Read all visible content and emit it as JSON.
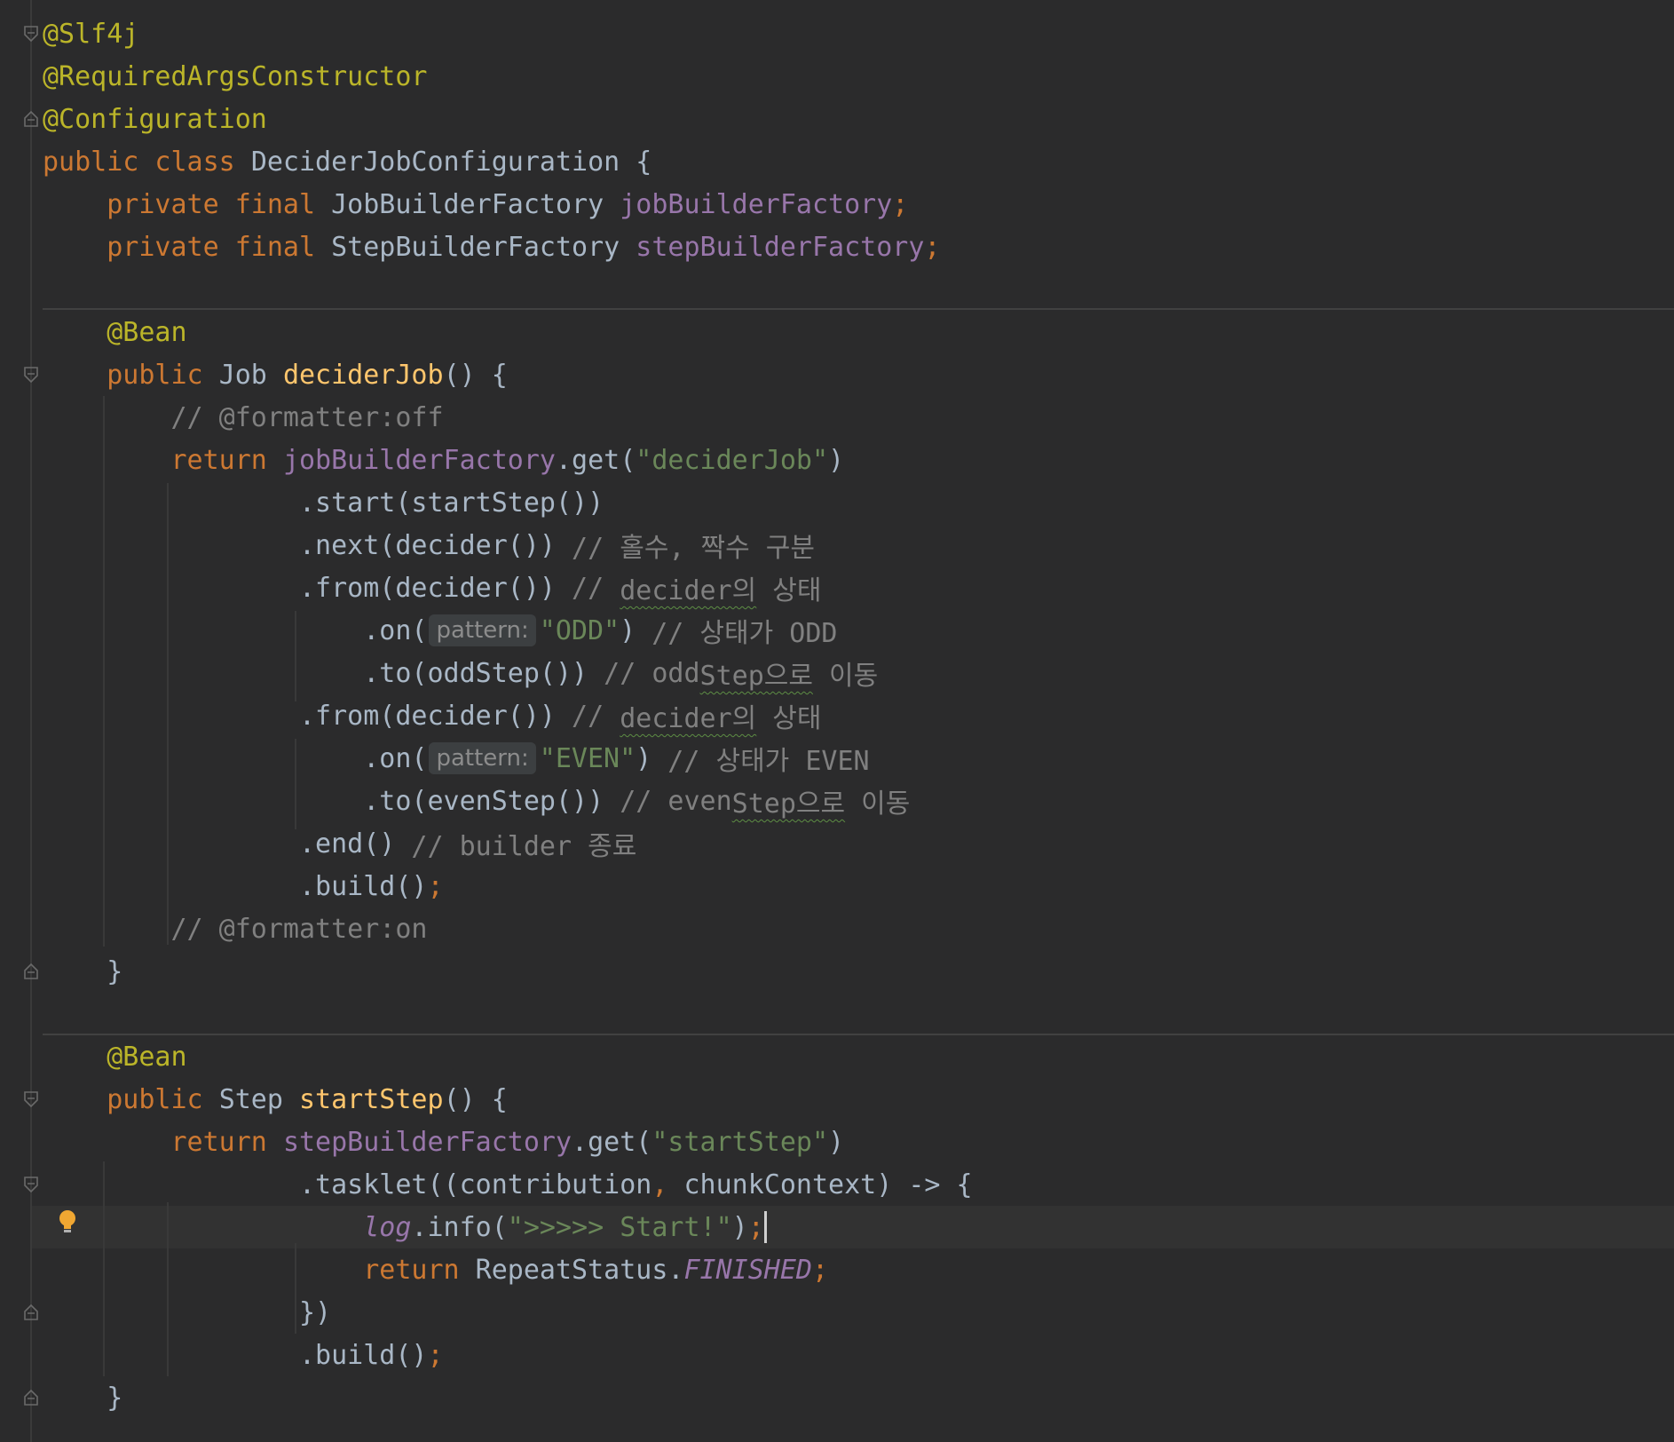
{
  "colors": {
    "background": "#2b2b2c",
    "keyword": "#cc7832",
    "annotation": "#bbb529",
    "field": "#9876aa",
    "method_declaration": "#ffc66d",
    "string": "#6a8759",
    "comment": "#808080",
    "plain": "#a9b7c6"
  },
  "icons": {
    "fold_markers": "fold-marker-icon",
    "intention": "lightbulb-icon"
  },
  "lines": [
    {
      "tokens": [
        {
          "t": "@Slf4j",
          "c": "ann"
        }
      ]
    },
    {
      "tokens": [
        {
          "t": "@RequiredArgsConstructor",
          "c": "ann"
        }
      ]
    },
    {
      "tokens": [
        {
          "t": "@Configuration",
          "c": "ann"
        }
      ]
    },
    {
      "tokens": [
        {
          "t": "public class ",
          "c": "kw"
        },
        {
          "t": "DeciderJobConfiguration {",
          "c": "cls"
        }
      ]
    },
    {
      "tokens": [
        {
          "t": "    private final ",
          "c": "kw"
        },
        {
          "t": "JobBuilderFactory ",
          "c": "cls"
        },
        {
          "t": "jobBuilderFactory",
          "c": "fld"
        },
        {
          "t": ";",
          "c": "semi"
        }
      ]
    },
    {
      "tokens": [
        {
          "t": "    private final ",
          "c": "kw"
        },
        {
          "t": "StepBuilderFactory ",
          "c": "cls"
        },
        {
          "t": "stepBuilderFactory",
          "c": "fld"
        },
        {
          "t": ";",
          "c": "semi"
        }
      ]
    },
    {
      "tokens": []
    },
    {
      "tokens": [
        {
          "t": "    @Bean",
          "c": "ann"
        }
      ]
    },
    {
      "tokens": [
        {
          "t": "    public ",
          "c": "kw"
        },
        {
          "t": "Job ",
          "c": "cls"
        },
        {
          "t": "deciderJob",
          "c": "fn"
        },
        {
          "t": "() {",
          "c": "cls"
        }
      ]
    },
    {
      "tokens": [
        {
          "t": "        // @formatter:off",
          "c": "cmt"
        }
      ]
    },
    {
      "tokens": [
        {
          "t": "        return ",
          "c": "kw"
        },
        {
          "t": "jobBuilderFactory",
          "c": "fld"
        },
        {
          "t": ".get(",
          "c": "cls"
        },
        {
          "t": "\"deciderJob\"",
          "c": "str"
        },
        {
          "t": ")",
          "c": "cls"
        }
      ]
    },
    {
      "tokens": [
        {
          "t": "                .start(startStep())",
          "c": "cls"
        }
      ]
    },
    {
      "tokens": [
        {
          "t": "                .next(decider()) ",
          "c": "cls"
        },
        {
          "t": "// 홀수, 짝수 구분",
          "c": "cmt"
        }
      ]
    },
    {
      "tokens": [
        {
          "t": "                .from(decider()) ",
          "c": "cls"
        },
        {
          "t": "// ",
          "c": "cmt"
        },
        {
          "t": "decider의",
          "c": "cmt squig"
        },
        {
          "t": " 상태",
          "c": "cmt"
        }
      ]
    },
    {
      "tokens": [
        {
          "t": "                    .on(",
          "c": "cls"
        },
        {
          "t": "pattern:",
          "c": "hint"
        },
        {
          "t": "\"ODD\"",
          "c": "str"
        },
        {
          "t": ") ",
          "c": "cls"
        },
        {
          "t": "// 상태가 ODD",
          "c": "cmt"
        }
      ]
    },
    {
      "tokens": [
        {
          "t": "                    .to(oddStep()) ",
          "c": "cls"
        },
        {
          "t": "// odd",
          "c": "cmt"
        },
        {
          "t": "Step으로",
          "c": "cmt squig"
        },
        {
          "t": " 이동",
          "c": "cmt"
        }
      ]
    },
    {
      "tokens": [
        {
          "t": "                .from(decider()) ",
          "c": "cls"
        },
        {
          "t": "// ",
          "c": "cmt"
        },
        {
          "t": "decider의",
          "c": "cmt squig"
        },
        {
          "t": " 상태",
          "c": "cmt"
        }
      ]
    },
    {
      "tokens": [
        {
          "t": "                    .on(",
          "c": "cls"
        },
        {
          "t": "pattern:",
          "c": "hint"
        },
        {
          "t": "\"EVEN\"",
          "c": "str"
        },
        {
          "t": ") ",
          "c": "cls"
        },
        {
          "t": "// 상태가 EVEN",
          "c": "cmt"
        }
      ]
    },
    {
      "tokens": [
        {
          "t": "                    .to(evenStep()) ",
          "c": "cls"
        },
        {
          "t": "// even",
          "c": "cmt"
        },
        {
          "t": "Step으로",
          "c": "cmt squig"
        },
        {
          "t": " 이동",
          "c": "cmt"
        }
      ]
    },
    {
      "tokens": [
        {
          "t": "                .end() ",
          "c": "cls"
        },
        {
          "t": "// builder 종료",
          "c": "cmt"
        }
      ]
    },
    {
      "tokens": [
        {
          "t": "                .build()",
          "c": "cls"
        },
        {
          "t": ";",
          "c": "semi"
        }
      ]
    },
    {
      "tokens": [
        {
          "t": "        // @formatter:on",
          "c": "cmt"
        }
      ]
    },
    {
      "tokens": [
        {
          "t": "    }",
          "c": "cls"
        }
      ]
    },
    {
      "tokens": []
    },
    {
      "tokens": [
        {
          "t": "    @Bean",
          "c": "ann"
        }
      ]
    },
    {
      "tokens": [
        {
          "t": "    public ",
          "c": "kw"
        },
        {
          "t": "Step ",
          "c": "cls"
        },
        {
          "t": "startStep",
          "c": "fn"
        },
        {
          "t": "() {",
          "c": "cls"
        }
      ]
    },
    {
      "tokens": [
        {
          "t": "        return ",
          "c": "kw"
        },
        {
          "t": "stepBuilderFactory",
          "c": "fld"
        },
        {
          "t": ".get(",
          "c": "cls"
        },
        {
          "t": "\"startStep\"",
          "c": "str"
        },
        {
          "t": ")",
          "c": "cls"
        }
      ]
    },
    {
      "tokens": [
        {
          "t": "                .tasklet((contribution",
          "c": "cls"
        },
        {
          "t": ", ",
          "c": "semi"
        },
        {
          "t": "chunkContext) -> {",
          "c": "cls"
        }
      ]
    },
    {
      "tokens": [
        {
          "t": "                    ",
          "c": "cls"
        },
        {
          "t": "log",
          "c": "fld it"
        },
        {
          "t": ".info(",
          "c": "cls"
        },
        {
          "t": "\">>>>> Start!\"",
          "c": "str"
        },
        {
          "t": ")",
          "c": "cls"
        },
        {
          "t": ";",
          "c": "semi"
        }
      ],
      "caret": true
    },
    {
      "tokens": [
        {
          "t": "                    return ",
          "c": "kw"
        },
        {
          "t": "RepeatStatus.",
          "c": "cls"
        },
        {
          "t": "FINISHED",
          "c": "fld it"
        },
        {
          "t": ";",
          "c": "semi"
        }
      ]
    },
    {
      "tokens": [
        {
          "t": "                })",
          "c": "cls"
        }
      ]
    },
    {
      "tokens": [
        {
          "t": "                .build()",
          "c": "cls"
        },
        {
          "t": ";",
          "c": "semi"
        }
      ]
    },
    {
      "tokens": [
        {
          "t": "    }",
          "c": "cls"
        }
      ]
    }
  ]
}
